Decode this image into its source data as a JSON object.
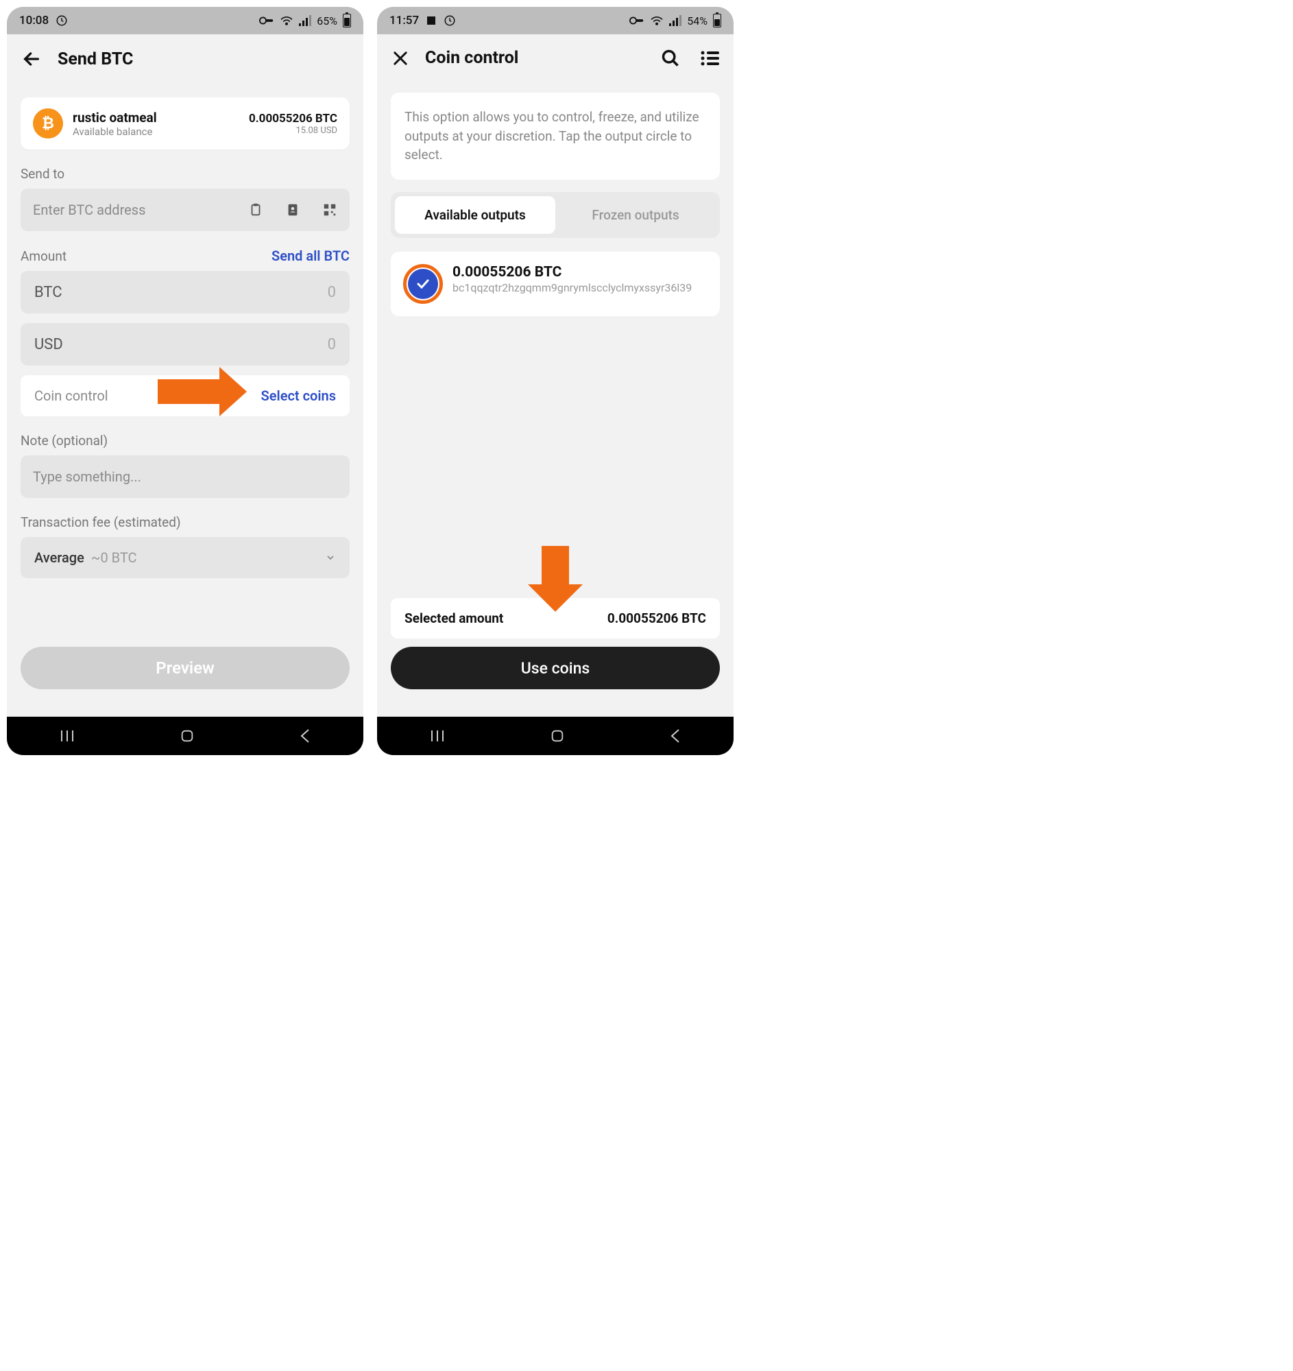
{
  "left": {
    "status": {
      "time": "10:08",
      "battery": "65%"
    },
    "header": {
      "title": "Send BTC"
    },
    "wallet": {
      "name": "rustic oatmeal",
      "sub": "Available balance",
      "btc": "0.00055206 BTC",
      "usd": "15.08 USD"
    },
    "sendto": {
      "label": "Send to",
      "placeholder": "Enter BTC address"
    },
    "amount": {
      "label": "Amount",
      "sendall": "Send all BTC",
      "rows": {
        "btc_label": "BTC",
        "btc_val": "0",
        "usd_label": "USD",
        "usd_val": "0"
      }
    },
    "coin": {
      "label": "Coin control",
      "link": "Select coins"
    },
    "note": {
      "label": "Note (optional)",
      "placeholder": "Type something..."
    },
    "fee": {
      "label": "Transaction fee (estimated)",
      "level": "Average",
      "amt": "~0 BTC"
    },
    "preview": "Preview"
  },
  "right": {
    "status": {
      "time": "11:57",
      "battery": "54%"
    },
    "header": {
      "title": "Coin control"
    },
    "info": "This option allows you to control, freeze, and utilize outputs at your discretion. Tap the output circle to select.",
    "tabs": {
      "available": "Available outputs",
      "frozen": "Frozen outputs"
    },
    "utxo": {
      "amt": "0.00055206 BTC",
      "addr": "bc1qqzqtr2hzgqmm9gnrymlscclyclmyxssyr36l39"
    },
    "selected": {
      "label": "Selected amount",
      "amt": "0.00055206 BTC"
    },
    "use": "Use coins"
  }
}
